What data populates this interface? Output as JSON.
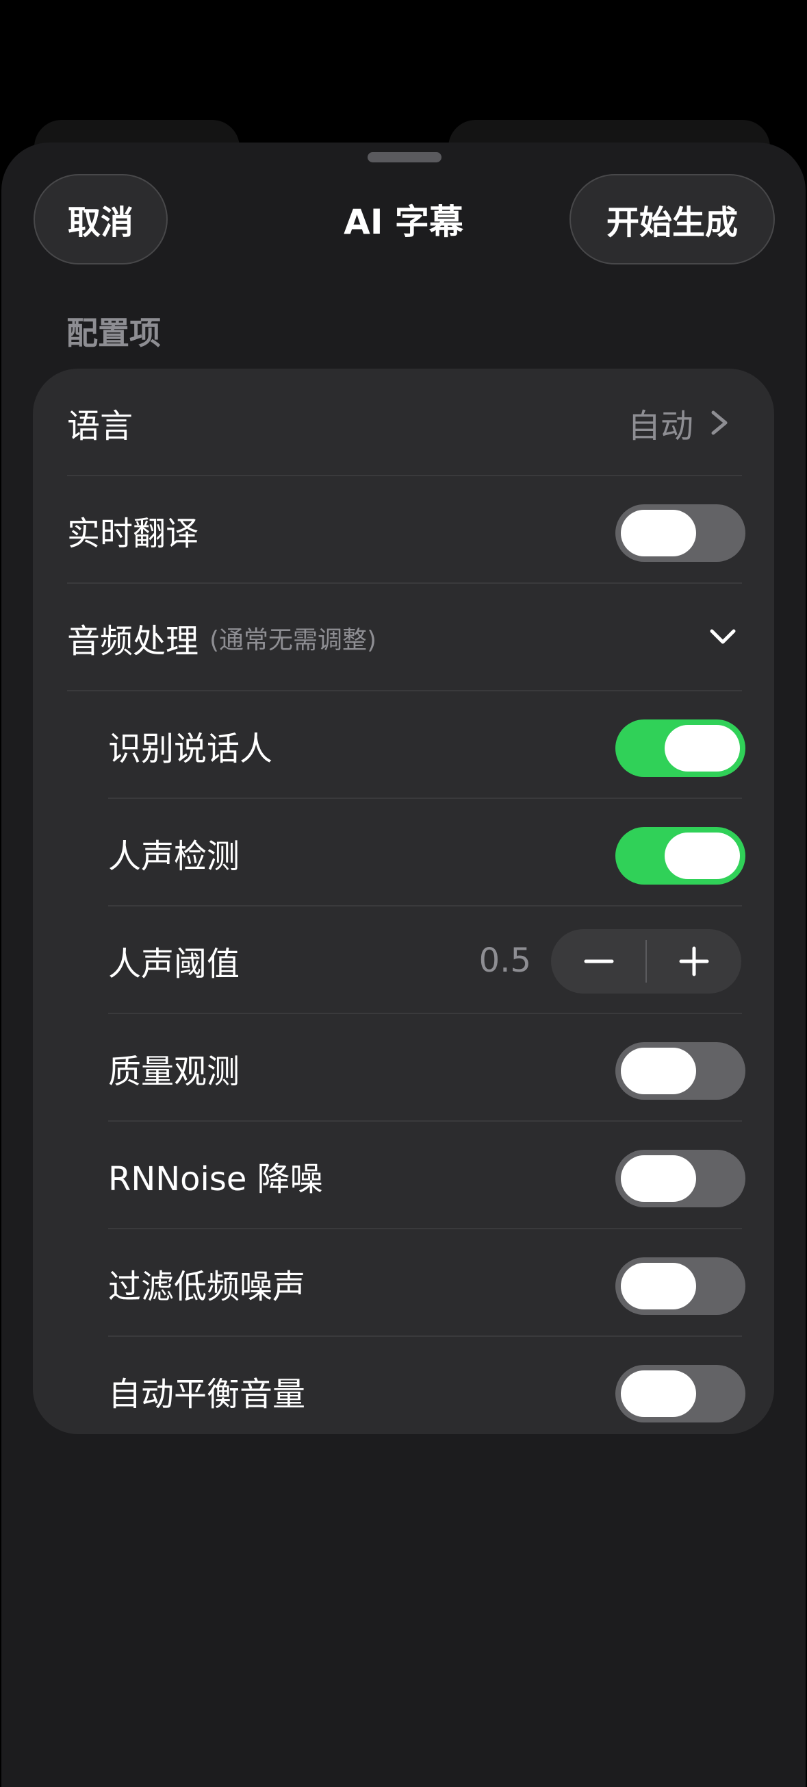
{
  "header": {
    "cancel_label": "取消",
    "title": "AI 字幕",
    "start_label": "开始生成"
  },
  "section": {
    "label": "配置项"
  },
  "settings": {
    "language": {
      "label": "语言",
      "value": "自动"
    },
    "realtime_translate": {
      "label": "实时翻译",
      "on": false
    },
    "audio_processing": {
      "label": "音频处理",
      "hint": "(通常无需调整)",
      "expanded": true
    },
    "speaker_diarization": {
      "label": "识别说话人",
      "on": true
    },
    "voice_detection": {
      "label": "人声检测",
      "on": true
    },
    "voice_threshold": {
      "label": "人声阈值",
      "value": "0.5"
    },
    "quality_monitor": {
      "label": "质量观测",
      "on": false
    },
    "rnnoise": {
      "label": "RNNoise 降噪",
      "on": false
    },
    "low_freq_filter": {
      "label": "过滤低频噪声",
      "on": false
    },
    "auto_volume": {
      "label": "自动平衡音量",
      "on": false
    }
  },
  "colors": {
    "toggle_on": "#30d158",
    "toggle_off": "#636366",
    "sheet_bg": "#1c1c1e",
    "card_bg": "#2c2c2e"
  }
}
